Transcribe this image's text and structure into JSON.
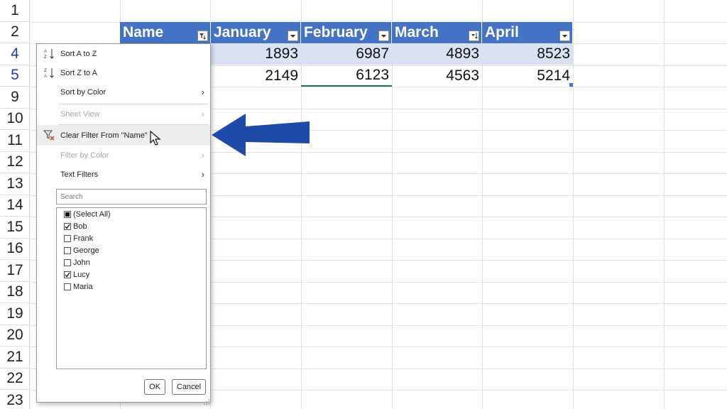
{
  "row_numbers": [
    "1",
    "2",
    "4",
    "5",
    "9",
    "10",
    "11",
    "12",
    "13",
    "14",
    "15",
    "16",
    "17",
    "18",
    "19",
    "20",
    "21",
    "22",
    "23"
  ],
  "table": {
    "headers": [
      "Name",
      "January",
      "February",
      "March",
      "April"
    ],
    "rows": [
      [
        "",
        "1893",
        "6987",
        "4893",
        "8523"
      ],
      [
        "",
        "2149",
        "6123",
        "4563",
        "5214"
      ]
    ],
    "header_color": "#4472c4",
    "band_color": "#d9e1f2"
  },
  "dropdown": {
    "menu": [
      {
        "label": "Sort A to Z",
        "icon": "sort-a-to-z-icon",
        "disabled": false
      },
      {
        "label": "Sort Z to A",
        "icon": "sort-z-to-a-icon",
        "disabled": false
      },
      {
        "label": "Sort by Color",
        "submenu": true,
        "disabled": false
      },
      {
        "label": "Sheet View",
        "submenu": true,
        "disabled": true
      },
      {
        "label": "Clear Filter From \"Name\"",
        "icon": "clear-filter-icon",
        "disabled": false
      },
      {
        "label": "Filter by Color",
        "submenu": true,
        "disabled": true
      },
      {
        "label": "Text Filters",
        "submenu": true,
        "disabled": false
      }
    ],
    "search_placeholder": "Search",
    "list": [
      {
        "label": "(Select All)",
        "state": "partial"
      },
      {
        "label": "Bob",
        "state": "checked"
      },
      {
        "label": "Frank",
        "state": "unchecked"
      },
      {
        "label": "George",
        "state": "unchecked"
      },
      {
        "label": "John",
        "state": "unchecked"
      },
      {
        "label": "Lucy",
        "state": "checked"
      },
      {
        "label": "Maria",
        "state": "unchecked"
      }
    ],
    "ok_label": "OK",
    "cancel_label": "Cancel"
  },
  "annotation": {
    "arrow_color": "#1f4aa8"
  }
}
